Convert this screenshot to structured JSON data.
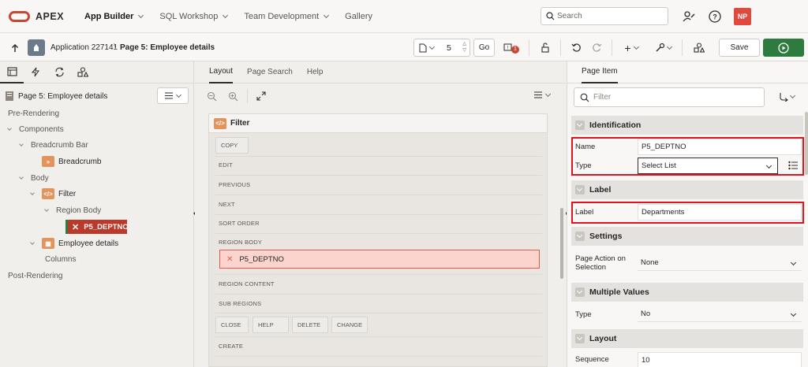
{
  "topnav": {
    "logo_text": "APEX",
    "tabs": [
      {
        "label": "App Builder",
        "active": true
      },
      {
        "label": "SQL Workshop",
        "active": false
      },
      {
        "label": "Team Development",
        "active": false
      },
      {
        "label": "Gallery",
        "active": false
      }
    ],
    "search_placeholder": "Search",
    "avatar_initials": "NP"
  },
  "toolbar": {
    "application_label": "Application 227141",
    "page_label": "Page 5: Employee details",
    "page_number": "5",
    "go_label": "Go",
    "save_label": "Save",
    "badge_count": "1"
  },
  "left_panel": {
    "page_title": "Page 5: Employee details",
    "tree": {
      "pre_rendering": "Pre-Rendering",
      "components": "Components",
      "breadcrumb_bar": "Breadcrumb Bar",
      "breadcrumb": "Breadcrumb",
      "body": "Body",
      "filter": "Filter",
      "region_body": "Region Body",
      "selected_item": "P5_DEPTNO",
      "employee_details": "Employee details",
      "columns": "Columns",
      "post_rendering": "Post-Rendering"
    }
  },
  "middle_panel": {
    "tabs": [
      {
        "label": "Layout",
        "active": true
      },
      {
        "label": "Page Search",
        "active": false
      },
      {
        "label": "Help",
        "active": false
      }
    ],
    "region_title": "Filter",
    "slots": {
      "copy": "COPY",
      "edit": "EDIT",
      "previous": "PREVIOUS",
      "next": "NEXT",
      "sort_order": "SORT ORDER",
      "region_body": "REGION BODY",
      "region_content": "REGION CONTENT",
      "sub_regions": "SUB REGIONS",
      "close": "CLOSE",
      "help": "HELP",
      "delete": "DELETE",
      "change": "CHANGE",
      "create": "CREATE"
    },
    "item_in_body": "P5_DEPTNO"
  },
  "right_panel": {
    "tab_label": "Page Item",
    "filter_placeholder": "Filter",
    "groups": {
      "identification": "Identification",
      "label": "Label",
      "settings": "Settings",
      "multiple_values": "Multiple Values",
      "layout": "Layout"
    },
    "properties": {
      "name_label": "Name",
      "name_value": "P5_DEPTNO",
      "type_label": "Type",
      "type_value": "Select List",
      "label_label": "Label",
      "label_value": "Departments",
      "page_action_label_1": "Page Action on",
      "page_action_label_2": "Selection",
      "page_action_value": "None",
      "mv_type_label": "Type",
      "mv_type_value": "No",
      "sequence_label": "Sequence",
      "sequence_value": "10"
    }
  },
  "colors": {
    "brand_red": "#c74634",
    "run_green": "#2d7b3f",
    "selected_item": "#b93a2b",
    "highlight_box": "#e0141e"
  }
}
